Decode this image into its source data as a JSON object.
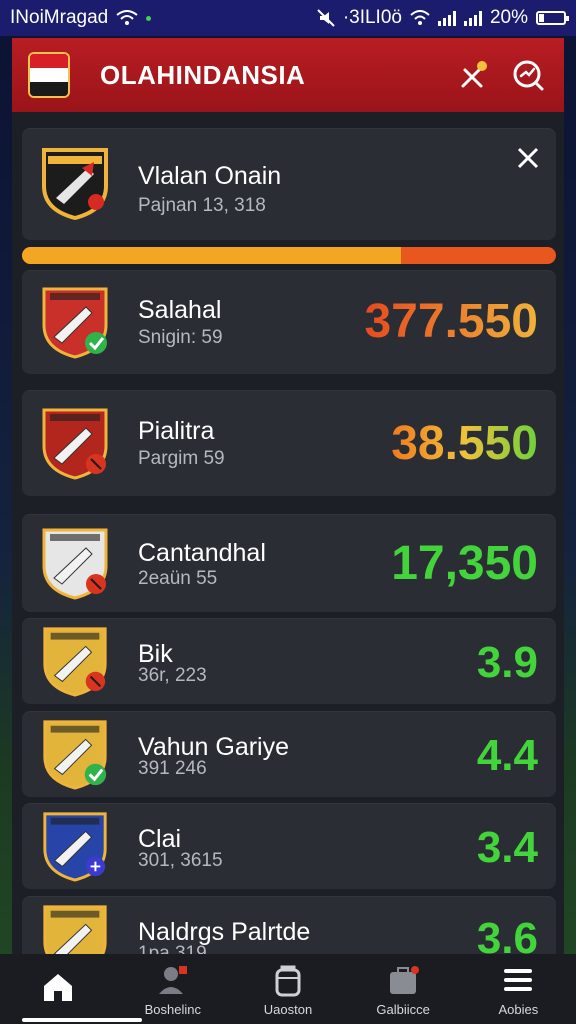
{
  "status_bar": {
    "carrier": "INoiMragad",
    "time": "·3ILI0ö",
    "battery_pct": "20%",
    "battery_level": 0.2
  },
  "app_bar": {
    "title": "OLAHINDANSIA",
    "flag_colors": [
      "#d61f26",
      "#ffffff",
      "#1a1a1a"
    ]
  },
  "featured": {
    "name": "Vlalan Onain",
    "subtitle": "Pajnan 13, 318",
    "close_icon": "close-icon"
  },
  "progress": {
    "value": 0.71,
    "fill_color": "#f3a621",
    "track_color": "#e8571e"
  },
  "players": [
    {
      "name": "Salahal",
      "subtitle": "Snigin: 59",
      "value": "377.550",
      "value_color": "gradient-orange",
      "badge_color": "#c9302a",
      "status": "check"
    },
    {
      "name": "Pialitra",
      "subtitle": "Pargim 59",
      "value": "38.550",
      "value_color": "gradient-orange-green",
      "badge_color": "#b3261e",
      "status": "red"
    },
    {
      "name": "Cantandhal",
      "subtitle": "2eaün 55",
      "value": "17,350",
      "value_color": "#42d43a",
      "badge_color": "#e6e6e6",
      "status": "red"
    },
    {
      "name": "Bik",
      "subtitle": "36r, 223",
      "value": "3.9",
      "value_color": "#42d43a",
      "badge_color": "#e3b43a",
      "status": "red"
    },
    {
      "name": "Vahun Gariye",
      "subtitle": "391 246",
      "value": "4.4",
      "value_color": "#42d43a",
      "badge_color": "#e3b43a",
      "status": "check"
    },
    {
      "name": "Clai",
      "subtitle": "301, 3615",
      "value": "3.4",
      "value_color": "#42d43a",
      "badge_color": "#2745a8",
      "status": "blue"
    },
    {
      "name": "Naldrgs Palrtde",
      "subtitle": "1pa 319",
      "value": "3.6",
      "value_color": "#42d43a",
      "badge_color": "#e3b43a",
      "status": "none"
    }
  ],
  "bottom_nav": [
    {
      "label": "",
      "icon": "home-icon",
      "active": true
    },
    {
      "label": "Boshelinc",
      "icon": "player-icon"
    },
    {
      "label": "Uaoston",
      "icon": "locker-icon"
    },
    {
      "label": "Galbiicce",
      "icon": "briefcase-icon"
    },
    {
      "label": "Aobies",
      "icon": "menu-icon"
    }
  ]
}
